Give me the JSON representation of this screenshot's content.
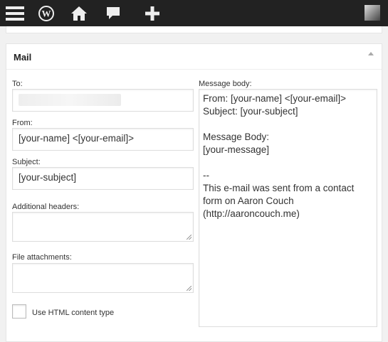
{
  "adminbar": {
    "icons": [
      "menu-icon",
      "wordpress-icon",
      "home-icon",
      "comments-icon",
      "plus-icon"
    ],
    "avatar_icon": "user-avatar"
  },
  "mail_panel": {
    "title": "Mail",
    "to": {
      "label": "To:",
      "value": ""
    },
    "from": {
      "label": "From:",
      "value": "[your-name] <[your-email]>"
    },
    "subject": {
      "label": "Subject:",
      "value": "[your-subject]"
    },
    "additional_headers": {
      "label": "Additional headers:",
      "value": ""
    },
    "file_attachments": {
      "label": "File attachments:",
      "value": ""
    },
    "html_content": {
      "label": "Use HTML content type",
      "checked": false
    },
    "message_body": {
      "label": "Message body:",
      "lines": [
        "From: [your-name] <[your-email]>",
        "Subject: [your-subject]",
        "",
        "Message Body:",
        "[your-message]",
        "",
        "--",
        "This e-mail was sent from a contact",
        "form on Aaron Couch",
        "(http://aaroncouch.me)"
      ]
    }
  },
  "colors": {
    "adminbar": "#222222",
    "page_bg": "#f1f1f1",
    "panel_bg": "#ffffff",
    "field_border": "#dddddd"
  }
}
